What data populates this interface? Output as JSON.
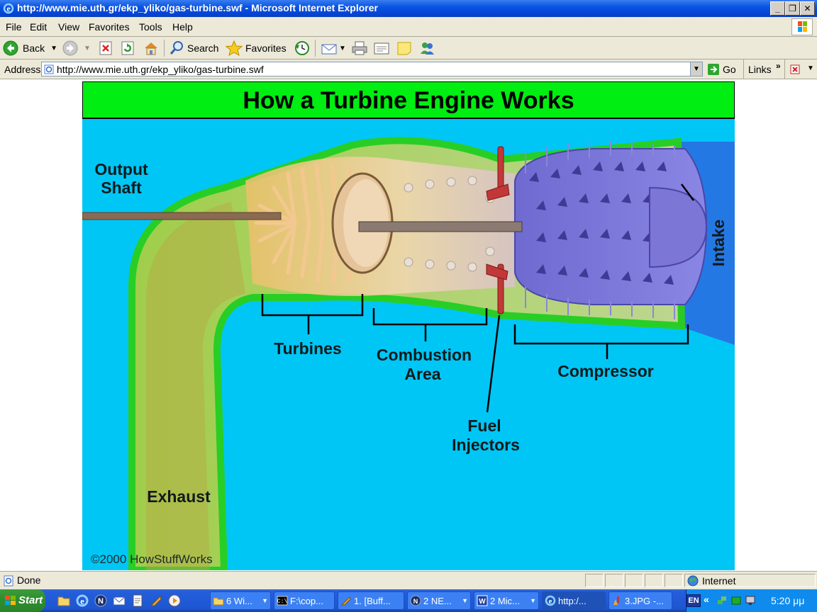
{
  "window": {
    "title": "http://www.mie.uth.gr/ekp_yliko/gas-turbine.swf - Microsoft Internet Explorer",
    "min": "_",
    "max": "❐",
    "close": "✕"
  },
  "menu": [
    "File",
    "Edit",
    "View",
    "Favorites",
    "Tools",
    "Help"
  ],
  "toolbar": {
    "back": "Back",
    "search": "Search",
    "favorites": "Favorites"
  },
  "address": {
    "label": "Address",
    "url": "http://www.mie.uth.gr/ekp_yliko/gas-turbine.swf",
    "go": "Go",
    "links": "Links"
  },
  "diagram": {
    "title": "How a Turbine Engine Works",
    "labels": {
      "output_shaft_1": "Output",
      "output_shaft_2": "Shaft",
      "turbines": "Turbines",
      "combustion_1": "Combustion",
      "combustion_2": "Area",
      "fuel_1": "Fuel",
      "fuel_2": "Injectors",
      "compressor": "Compressor",
      "intake": "Intake",
      "exhaust": "Exhaust",
      "copyright": "©2000 HowStuffWorks"
    },
    "colors": {
      "title_bg": "#00ee11",
      "background": "#00c6f6",
      "shell": "#7ee020",
      "compressor": "#6a64c8",
      "injector": "#c23838"
    }
  },
  "status": {
    "text": "Done",
    "zone": "Internet"
  },
  "taskbar": {
    "start": "Start",
    "tasks": [
      "6 Wi...",
      "F:\\cop...",
      "1. [Buff...",
      "2 NE...",
      "2 Mic...",
      "http:/...",
      "3.JPG -..."
    ],
    "lang": "EN",
    "clock": "5:20 μμ"
  }
}
